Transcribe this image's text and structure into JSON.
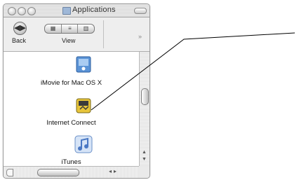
{
  "window": {
    "title": "Applications"
  },
  "toolbar": {
    "back_label": "Back",
    "back_glyph": "◀▶",
    "view_label": "View",
    "view_modes": [
      "▦",
      "≡",
      "▥"
    ],
    "grip_glyph": "»"
  },
  "items": [
    {
      "label": "iMovie for Mac OS X",
      "icon": "imovie-icon"
    },
    {
      "label": "Internet Connect",
      "icon": "internet-connect-icon"
    },
    {
      "label": "iTunes",
      "icon": "itunes-icon"
    }
  ],
  "scroll": {
    "up": "▲",
    "down": "▼",
    "left": "◂",
    "right": "▸"
  },
  "colors": {
    "callout_line": "#000000",
    "imovie_blue": "#5a93d6",
    "internet_connect_yellow": "#e8c53a",
    "itunes_blue": "#4a78c4"
  }
}
